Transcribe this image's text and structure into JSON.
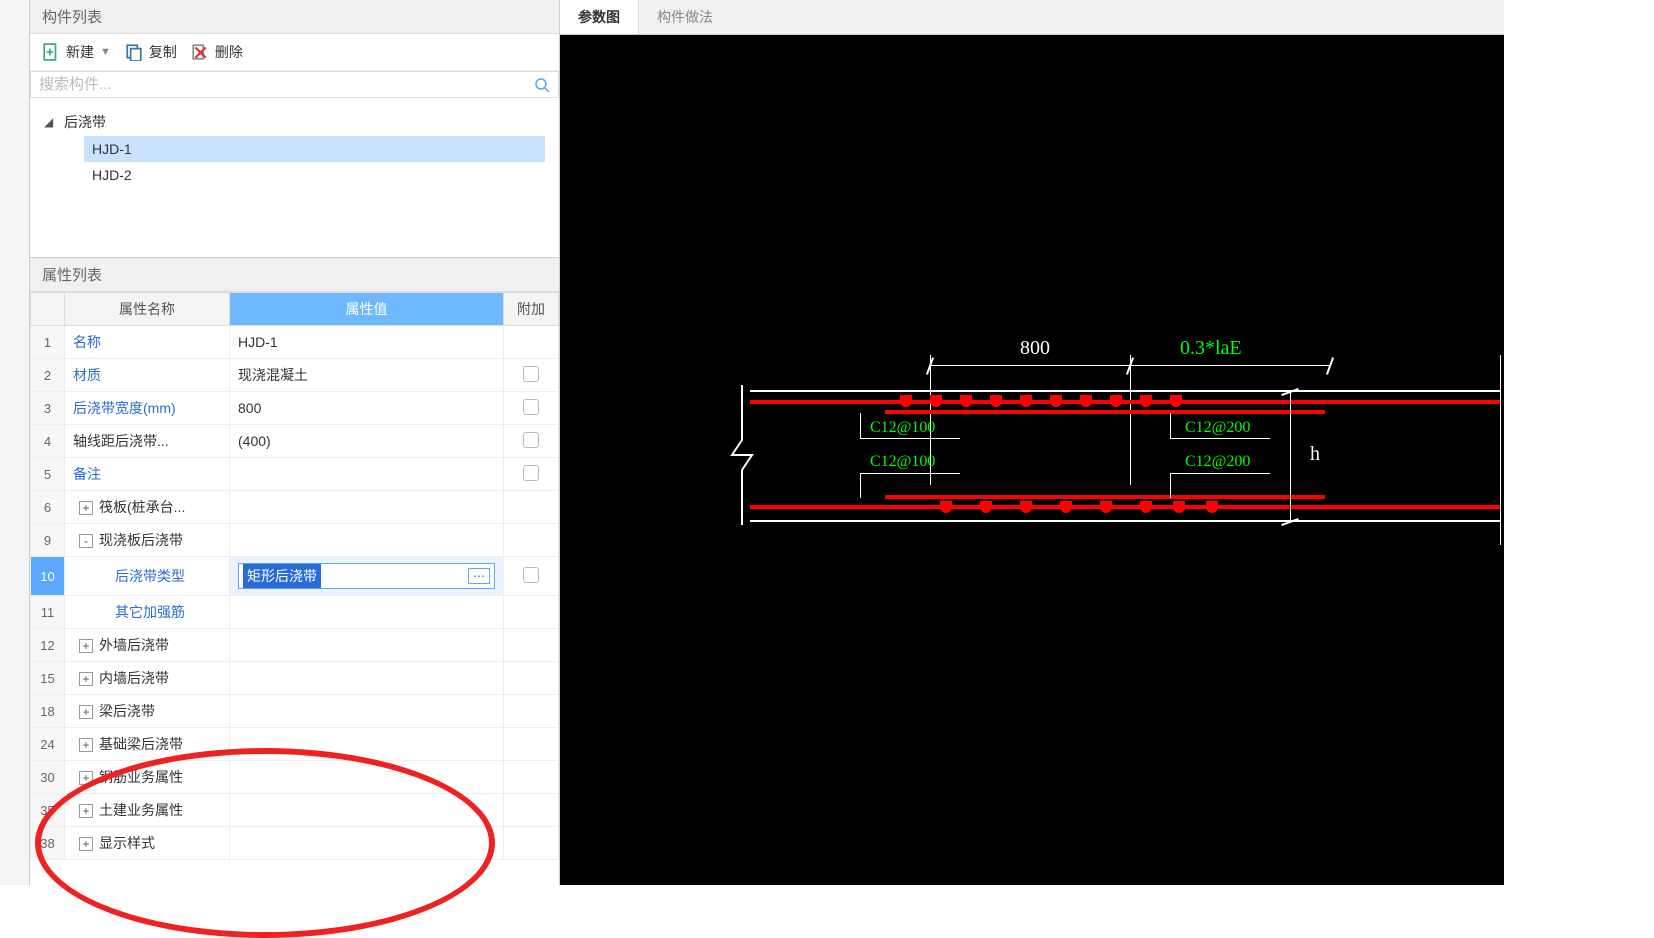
{
  "componentList": {
    "header": "构件列表",
    "toolbar": {
      "new": "新建",
      "copy": "复制",
      "delete": "删除"
    },
    "searchPlaceholder": "搜索构件...",
    "tree": {
      "parent": "后浇带",
      "children": [
        "HJD-1",
        "HJD-2"
      ],
      "selected": "HJD-1"
    }
  },
  "propList": {
    "header": "属性列表",
    "columns": {
      "name": "属性名称",
      "value": "属性值",
      "extra": "附加"
    },
    "rows": [
      {
        "num": "1",
        "name": "名称",
        "value": "HJD-1",
        "blue": true,
        "cb": false
      },
      {
        "num": "2",
        "name": "材质",
        "value": "现浇混凝土",
        "blue": true,
        "cb": true
      },
      {
        "num": "3",
        "name": "后浇带宽度(mm)",
        "value": "800",
        "blue": true,
        "cb": true
      },
      {
        "num": "4",
        "name": "轴线距后浇带...",
        "value": "(400)",
        "blue": false,
        "cb": true
      },
      {
        "num": "5",
        "name": "备注",
        "value": "",
        "blue": true,
        "cb": true
      },
      {
        "num": "6",
        "name": "筏板(桩承台...",
        "value": "",
        "expand": "+",
        "cb": false
      },
      {
        "num": "9",
        "name": "现浇板后浇带",
        "value": "",
        "expand": "-",
        "cb": false
      },
      {
        "num": "10",
        "name": "后浇带类型",
        "value": "矩形后浇带",
        "indent2": true,
        "active": true,
        "cb": true
      },
      {
        "num": "11",
        "name": "其它加强筋",
        "value": "",
        "indent2": true,
        "cb": false
      },
      {
        "num": "12",
        "name": "外墙后浇带",
        "value": "",
        "expand": "+",
        "cb": false
      },
      {
        "num": "15",
        "name": "内墙后浇带",
        "value": "",
        "expand": "+",
        "cb": false
      },
      {
        "num": "18",
        "name": "梁后浇带",
        "value": "",
        "expand": "+",
        "cb": false
      },
      {
        "num": "24",
        "name": "基础梁后浇带",
        "value": "",
        "expand": "+",
        "cb": false
      },
      {
        "num": "30",
        "name": "钢筋业务属性",
        "value": "",
        "expand": "+",
        "cb": false
      },
      {
        "num": "35",
        "name": "土建业务属性",
        "value": "",
        "expand": "+",
        "cb": false
      },
      {
        "num": "38",
        "name": "显示样式",
        "value": "",
        "expand": "+",
        "cb": false
      }
    ]
  },
  "rightTabs": {
    "tab1": "参数图",
    "tab2": "构件做法"
  },
  "diagram": {
    "width": "800",
    "anchor": "0.3*laE",
    "height": "h",
    "rebarLeft": "C12@100",
    "rebarRight": "C12@200"
  },
  "chart_data": {
    "type": "diagram-section",
    "description": "后浇带 (post-cast strip) cross-section",
    "dimensions": {
      "width_mm": 800,
      "anchor_length": "0.3*laE",
      "section_height": "h"
    },
    "rebar": [
      {
        "location": "top-left",
        "spec": "C12@100"
      },
      {
        "location": "bottom-left",
        "spec": "C12@100"
      },
      {
        "location": "top-right",
        "spec": "C12@200"
      },
      {
        "location": "bottom-right",
        "spec": "C12@200"
      }
    ]
  }
}
